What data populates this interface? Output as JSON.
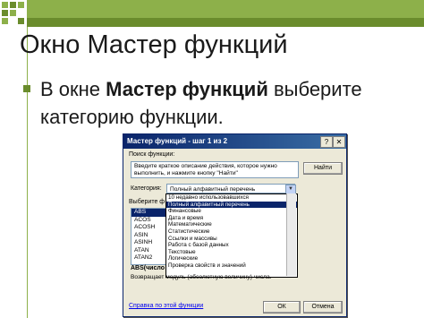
{
  "slide": {
    "title": "Окно Мастер функций",
    "bullet_prefix": "В окне ",
    "bullet_bold": "Мастер функций",
    "bullet_suffix": " выберите категорию функции."
  },
  "dialog": {
    "title": "Мастер функций - шаг 1 из 2",
    "help_btn": "?",
    "close_btn": "✕",
    "search_label": "Поиск функции:",
    "search_value": "Введите краткое описание действия, которое нужно выполнить, и нажмите кнопку \"Найти\"",
    "find_button": "Найти",
    "category_label": "Категория:",
    "category_value": "Полный алфавитный перечень",
    "function_label": "Выберите ф",
    "functions": [
      "ABS",
      "ACOS",
      "ACOSH",
      "ASIN",
      "ASINH",
      "ATAN",
      "ATAN2"
    ],
    "category_options": [
      "10 недавно использовавшихся",
      "Полный алфавитный перечень",
      "Финансовые",
      "Дата и время",
      "Математические",
      "Статистические",
      "Ссылки и массивы",
      "Работа с базой данных",
      "Текстовые",
      "Логические",
      "Проверка свойств и значений"
    ],
    "syntax_text": "ABS(число",
    "description_text": "Возвращает модуль (абсолютную величину) числа.",
    "help_link": "Справка по этой функции",
    "ok_button": "ОК",
    "cancel_button": "Отмена"
  },
  "colors": {
    "accent_green": "#8db04a",
    "dark_green": "#6a8c2c",
    "titlebar_blue": "#0a246a"
  }
}
